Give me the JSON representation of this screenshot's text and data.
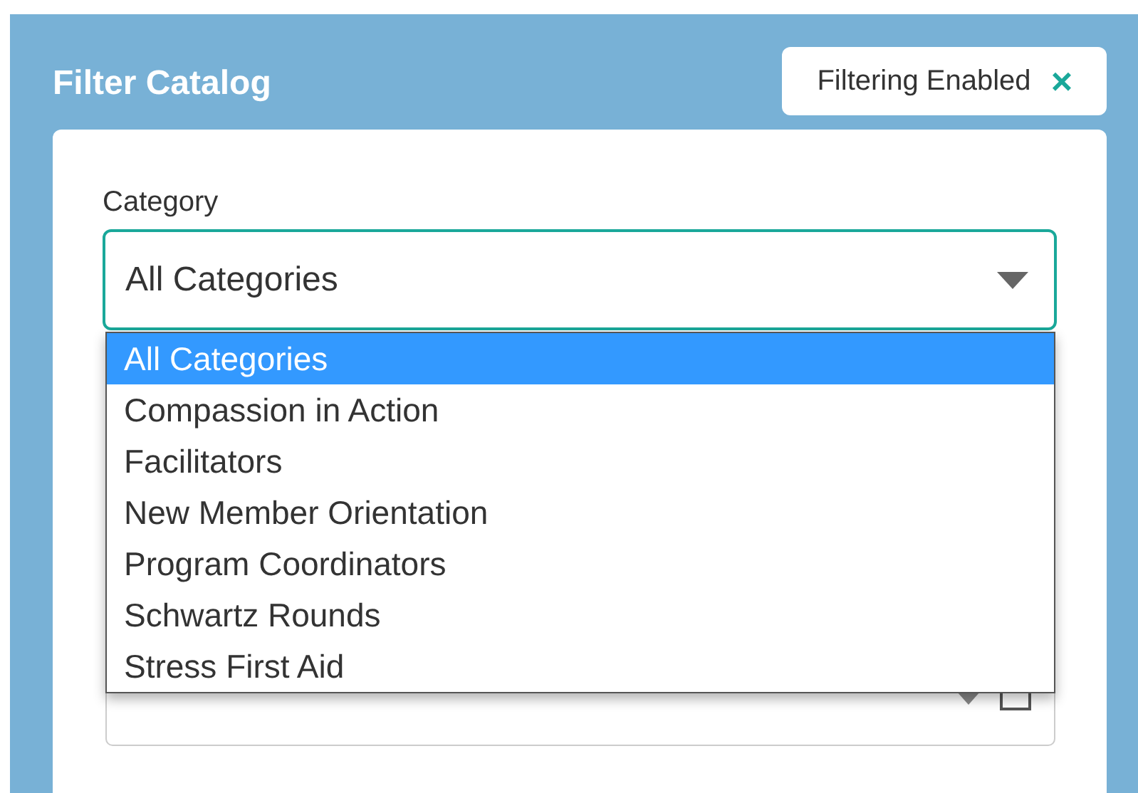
{
  "panel": {
    "title": "Filter Catalog",
    "chip": {
      "label": "Filtering Enabled",
      "close": "×"
    }
  },
  "category": {
    "label": "Category",
    "value": "All Categories",
    "expanded": true,
    "options": [
      {
        "label": "All Categories",
        "selected": true
      },
      {
        "label": "Compassion in Action",
        "selected": false
      },
      {
        "label": "Facilitators",
        "selected": false
      },
      {
        "label": "New Member Orientation",
        "selected": false
      },
      {
        "label": "Program Coordinators",
        "selected": false
      },
      {
        "label": "Schwartz Rounds",
        "selected": false
      },
      {
        "label": "Stress First Aid",
        "selected": false
      }
    ]
  }
}
